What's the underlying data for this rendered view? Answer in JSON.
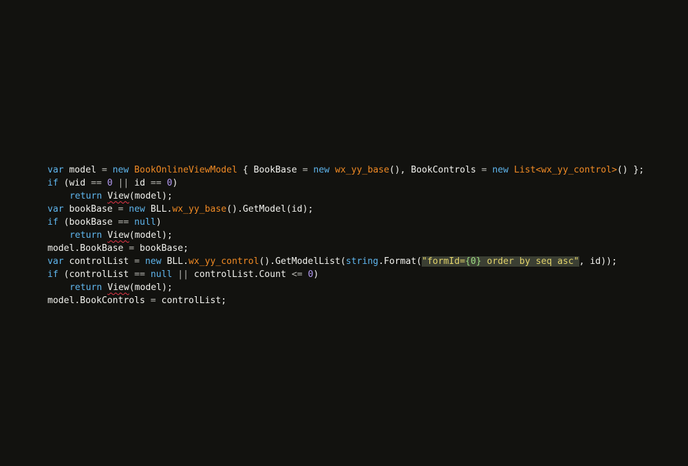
{
  "editor": {
    "background": "#12120f",
    "colors": {
      "keyword": "#5fb6ee",
      "type": "#f08a24",
      "number": "#b39af2",
      "string": "#e2d36a",
      "string_highlight": "#3b3f33",
      "placeholder": "#9cdc82",
      "text": "#f2f2ee",
      "error_underline": "#e8364a"
    },
    "lines": [
      {
        "tokens": [
          {
            "t": "var",
            "c": "kw"
          },
          {
            "t": " model ",
            "c": "plain"
          },
          {
            "t": "=",
            "c": "op"
          },
          {
            "t": " ",
            "c": "plain"
          },
          {
            "t": "new",
            "c": "kw"
          },
          {
            "t": " ",
            "c": "plain"
          },
          {
            "t": "BookOnlineViewModel",
            "c": "type"
          },
          {
            "t": " { BookBase ",
            "c": "plain"
          },
          {
            "t": "=",
            "c": "op"
          },
          {
            "t": " ",
            "c": "plain"
          },
          {
            "t": "new",
            "c": "kw"
          },
          {
            "t": " ",
            "c": "plain"
          },
          {
            "t": "wx_yy_base",
            "c": "type"
          },
          {
            "t": "(), BookControls ",
            "c": "plain"
          },
          {
            "t": "=",
            "c": "op"
          },
          {
            "t": " ",
            "c": "plain"
          },
          {
            "t": "new",
            "c": "kw"
          },
          {
            "t": " ",
            "c": "plain"
          },
          {
            "t": "List<wx_yy_control>",
            "c": "type"
          },
          {
            "t": "() };",
            "c": "plain"
          }
        ]
      },
      {
        "tokens": [
          {
            "t": "if",
            "c": "kw"
          },
          {
            "t": " (wid ",
            "c": "plain"
          },
          {
            "t": "==",
            "c": "op"
          },
          {
            "t": " ",
            "c": "plain"
          },
          {
            "t": "0",
            "c": "num"
          },
          {
            "t": " ",
            "c": "plain"
          },
          {
            "t": "||",
            "c": "op"
          },
          {
            "t": " id ",
            "c": "plain"
          },
          {
            "t": "==",
            "c": "op"
          },
          {
            "t": " ",
            "c": "plain"
          },
          {
            "t": "0",
            "c": "num"
          },
          {
            "t": ")",
            "c": "plain"
          }
        ]
      },
      {
        "indent": true,
        "tokens": [
          {
            "t": "return",
            "c": "kw"
          },
          {
            "t": " ",
            "c": "plain"
          },
          {
            "t": "View",
            "c": "plain squig"
          },
          {
            "t": "(model);",
            "c": "plain"
          }
        ]
      },
      {
        "tokens": [
          {
            "t": "var",
            "c": "kw"
          },
          {
            "t": " bookBase ",
            "c": "plain"
          },
          {
            "t": "=",
            "c": "op"
          },
          {
            "t": " ",
            "c": "plain"
          },
          {
            "t": "new",
            "c": "kw"
          },
          {
            "t": " BLL.",
            "c": "plain"
          },
          {
            "t": "wx_yy_base",
            "c": "type"
          },
          {
            "t": "().GetModel(id);",
            "c": "plain"
          }
        ]
      },
      {
        "tokens": [
          {
            "t": "if",
            "c": "kw"
          },
          {
            "t": " (bookBase ",
            "c": "plain"
          },
          {
            "t": "==",
            "c": "op"
          },
          {
            "t": " ",
            "c": "plain"
          },
          {
            "t": "null",
            "c": "kw"
          },
          {
            "t": ")",
            "c": "plain"
          }
        ]
      },
      {
        "indent": true,
        "tokens": [
          {
            "t": "return",
            "c": "kw"
          },
          {
            "t": " ",
            "c": "plain"
          },
          {
            "t": "View",
            "c": "plain squig"
          },
          {
            "t": "(model);",
            "c": "plain"
          }
        ]
      },
      {
        "tokens": [
          {
            "t": "model.BookBase ",
            "c": "plain"
          },
          {
            "t": "=",
            "c": "op"
          },
          {
            "t": " bookBase;",
            "c": "plain"
          }
        ]
      },
      {
        "tokens": [
          {
            "t": "var",
            "c": "kw"
          },
          {
            "t": " controlList ",
            "c": "plain"
          },
          {
            "t": "=",
            "c": "op"
          },
          {
            "t": " ",
            "c": "plain"
          },
          {
            "t": "new",
            "c": "kw"
          },
          {
            "t": " BLL.",
            "c": "plain"
          },
          {
            "t": "wx_yy_control",
            "c": "type"
          },
          {
            "t": "().GetModelList(",
            "c": "plain"
          },
          {
            "t": "string",
            "c": "kw"
          },
          {
            "t": ".Format(",
            "c": "plain"
          },
          {
            "t": "\"formId=",
            "c": "str"
          },
          {
            "t": "{0}",
            "c": "str strp"
          },
          {
            "t": " order by seq asc\"",
            "c": "str"
          },
          {
            "t": ", id));",
            "c": "plain"
          }
        ]
      },
      {
        "tokens": [
          {
            "t": "if",
            "c": "kw"
          },
          {
            "t": " (controlList ",
            "c": "plain"
          },
          {
            "t": "==",
            "c": "op"
          },
          {
            "t": " ",
            "c": "plain"
          },
          {
            "t": "null",
            "c": "kw"
          },
          {
            "t": " ",
            "c": "plain"
          },
          {
            "t": "||",
            "c": "op"
          },
          {
            "t": " controlList.Count ",
            "c": "plain"
          },
          {
            "t": "<=",
            "c": "op"
          },
          {
            "t": " ",
            "c": "plain"
          },
          {
            "t": "0",
            "c": "num"
          },
          {
            "t": ")",
            "c": "plain"
          }
        ]
      },
      {
        "indent": true,
        "tokens": [
          {
            "t": "return",
            "c": "kw"
          },
          {
            "t": " ",
            "c": "plain"
          },
          {
            "t": "View",
            "c": "plain squig"
          },
          {
            "t": "(model);",
            "c": "plain"
          }
        ]
      },
      {
        "tokens": [
          {
            "t": "model.BookControls ",
            "c": "plain"
          },
          {
            "t": "=",
            "c": "op"
          },
          {
            "t": " controlList;",
            "c": "plain"
          }
        ]
      }
    ]
  }
}
